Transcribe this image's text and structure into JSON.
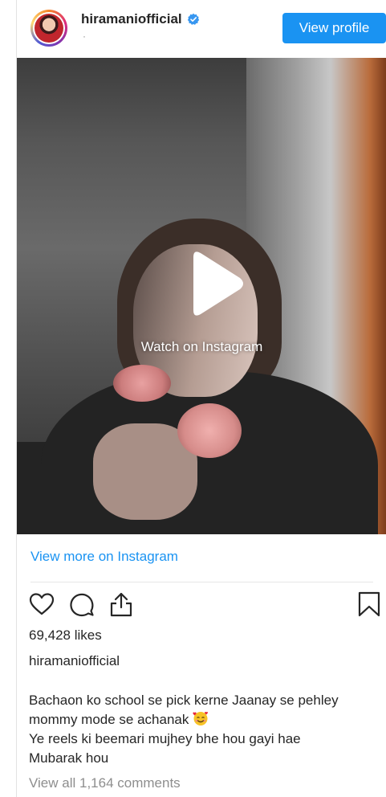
{
  "header": {
    "username": "hiramaniofficial",
    "subtitle": "·",
    "view_profile_label": "View profile"
  },
  "media": {
    "watch_label": "Watch on Instagram"
  },
  "footer": {
    "view_more_label": "View more on Instagram",
    "likes": "69,428 likes",
    "caption_user": "hiramaniofficial",
    "caption_lines": [
      "Bachaon ko school se pick kerne Jaanay se pehley",
      "mommy mode se achanak",
      "Ye reels ki beemari mujhey bhe hou gayi hae",
      "Mubarak hou"
    ],
    "comments_label": "View all 1,164 comments"
  },
  "icons": {
    "avatar": "profile-avatar",
    "verified": "verified-badge-icon",
    "play": "play-icon",
    "like": "heart-icon",
    "comment": "comment-icon",
    "share": "share-icon",
    "save": "bookmark-icon",
    "emoji": "smiling-face-with-hearts-emoji"
  },
  "colors": {
    "accent": "#1a93f2",
    "text": "#262626",
    "muted": "#8e8e8e"
  }
}
